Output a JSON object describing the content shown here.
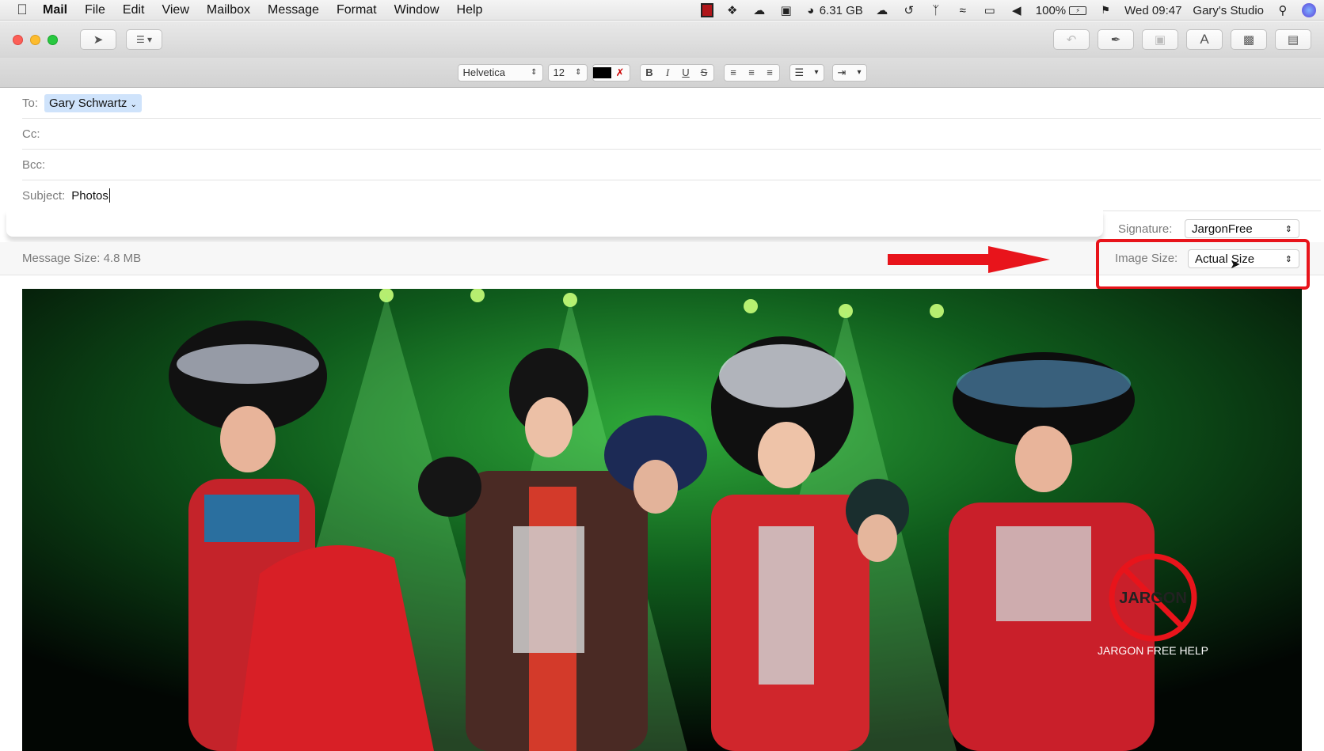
{
  "menubar": {
    "app_name": "Mail",
    "items": [
      "File",
      "Edit",
      "View",
      "Mailbox",
      "Message",
      "Format",
      "Window",
      "Help"
    ],
    "memory": "6.31 GB",
    "battery": "100%",
    "clock": "Wed 09:47",
    "user": "Gary's Studio",
    "icons": [
      "apple-icon",
      "screen-recording-icon",
      "dropbox-icon",
      "creative-cloud-icon",
      "html5-icon",
      "memory-gauge-icon",
      "cloud-backup-icon",
      "time-machine-icon",
      "bluetooth-icon",
      "wifi-icon",
      "airplay-icon",
      "volume-icon",
      "battery-icon",
      "us-flag-icon",
      "spotlight-icon",
      "siri-icon"
    ]
  },
  "toolbar": {
    "left_icons": [
      "send-icon",
      "header-fields-icon"
    ],
    "right_icons": [
      "reply-icon",
      "attachment-icon",
      "markup-icon",
      "format-icon",
      "photo-browser-icon",
      "stationery-icon"
    ]
  },
  "formatbar": {
    "font": "Helvetica",
    "size": "12",
    "text_color": "#000000"
  },
  "headers": {
    "to_label": "To:",
    "to_value": "Gary Schwartz",
    "cc_label": "Cc:",
    "bcc_label": "Bcc:",
    "subject_label": "Subject:",
    "subject_value": "Photos"
  },
  "signature": {
    "label": "Signature:",
    "value": "JargonFree"
  },
  "message": {
    "size_label": "Message Size:",
    "size_value": "4.8 MB",
    "image_size_label": "Image Size:",
    "image_size_value": "Actual Size"
  },
  "annotation": {
    "color": "#e8141b"
  },
  "watermark": {
    "logo_text": "JARGON",
    "caption": "JARGON FREE HELP"
  }
}
